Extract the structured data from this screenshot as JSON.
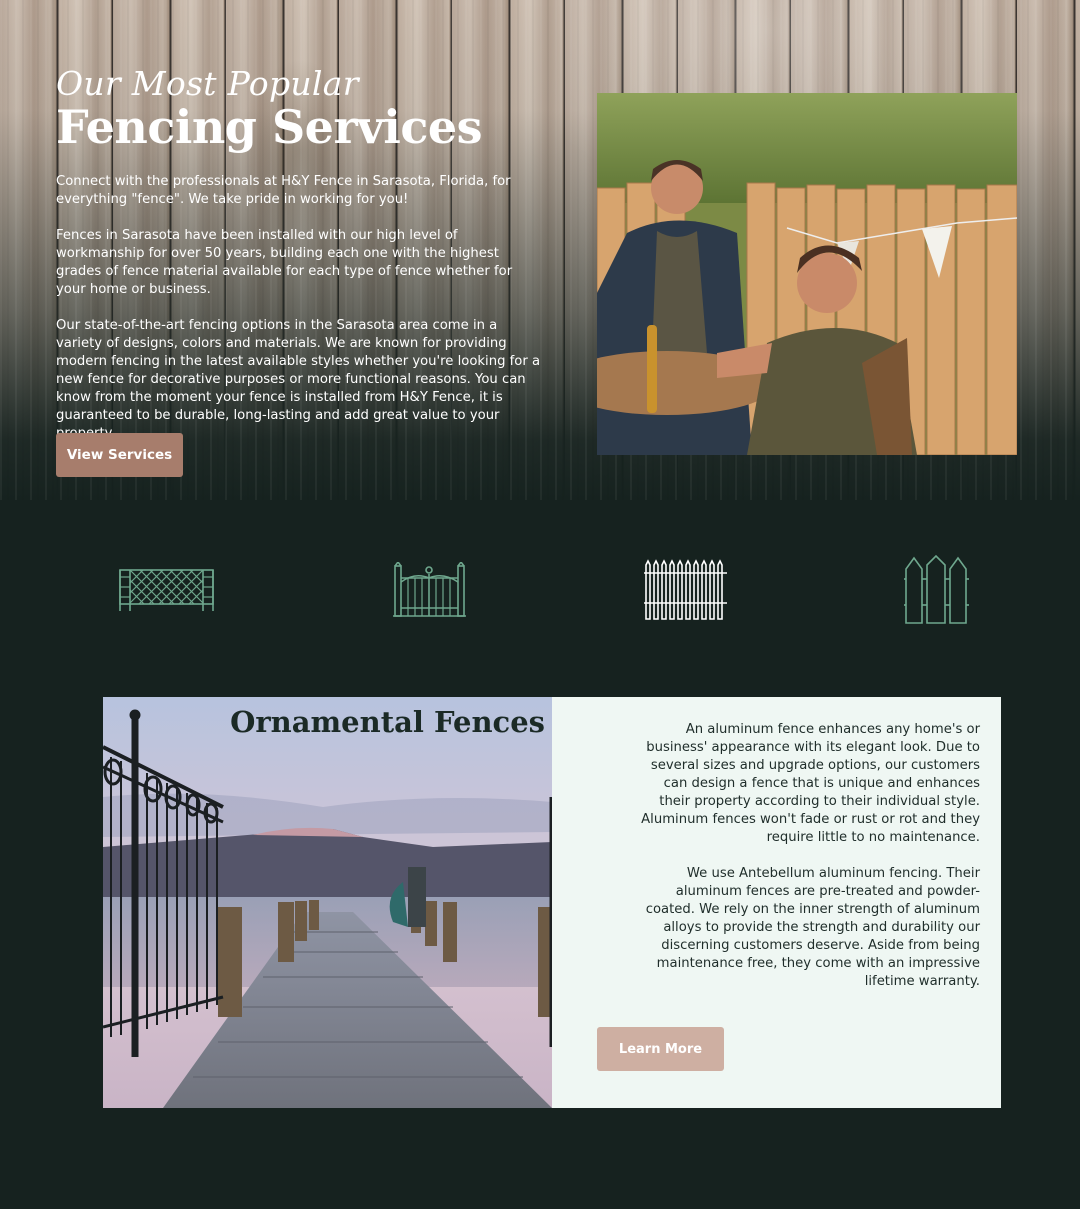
{
  "hero": {
    "kicker": "Our Most Popular",
    "title": "Fencing Services",
    "paragraphs": [
      "Connect with the professionals at H&Y Fence in Sarasota, Florida, for everything \"fence\". We take pride in working for you!",
      "Fences in Sarasota have been installed with our high level of workmanship for over 50 years, building each one with the highest grades of fence material available for each type of fence whether for your home or business.",
      "Our state-of-the-art fencing options in the Sarasota area come in a variety of designs, colors and materials. We are known for providing modern fencing in the latest available styles whether you're looking for a new fence for decorative purposes or more functional reasons. You can know from the moment your fence is installed from H&Y Fence, it is guaranteed to be durable, long-lasting and add great value to your property."
    ],
    "button_label": "View Services"
  },
  "fence_types": [
    {
      "icon": "lattice-fence-icon",
      "color": "#6fa88e"
    },
    {
      "icon": "aluminum-gate-fence-icon",
      "color": "#6fa88e"
    },
    {
      "icon": "picket-fence-icon",
      "color": "#ffffff"
    },
    {
      "icon": "wood-privacy-fence-icon",
      "color": "#6fa88e"
    }
  ],
  "ornamental": {
    "title": "Ornamental Fences",
    "paragraphs": [
      "An aluminum fence enhances any home's or business' appearance with its elegant look. Due to several sizes and upgrade options, our customers can design a fence that is unique and enhances their property according to their individual style. Aluminum fences won't fade or rust or rot and they require little to no maintenance.",
      "We use Antebellum aluminum fencing. Their aluminum fences are pre-treated and powder-coated. We rely on the inner strength of aluminum alloys to provide the strength and durability our discerning customers deserve. Aside from being maintenance free, they come with an impressive lifetime warranty."
    ],
    "button_label": "Learn More"
  },
  "colors": {
    "background": "#16221f",
    "accent": "#a77d6c",
    "accent_light": "#ceafa2",
    "icon_green": "#6fa88e",
    "card_bg": "#eff7f3"
  }
}
